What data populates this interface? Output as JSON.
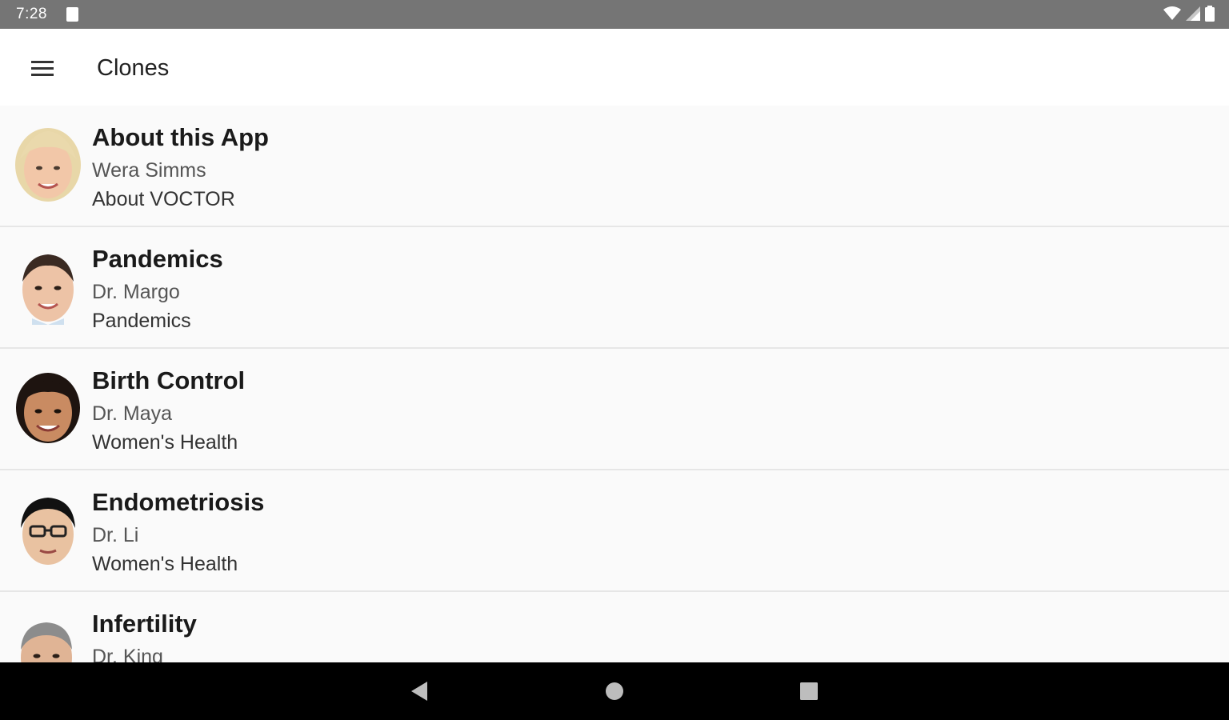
{
  "status_bar": {
    "time": "7:28",
    "icons": [
      "sd-card-icon",
      "wifi-icon",
      "cell-signal-icon",
      "battery-icon"
    ]
  },
  "app_bar": {
    "title": "Clones",
    "menu_icon": "menu-icon"
  },
  "items": [
    {
      "title": "About this App",
      "name": "Wera Simms",
      "category": "About VOCTOR",
      "avatar": "avatar-blonde-woman",
      "skin": "#f2c7a8",
      "hair": "#e8d7a8"
    },
    {
      "title": "Pandemics",
      "name": "Dr. Margo",
      "category": "Pandemics",
      "avatar": "avatar-doctor-woman",
      "skin": "#edc3a6",
      "hair": "#3a2a22"
    },
    {
      "title": "Birth Control",
      "name": "Dr. Maya",
      "category": "Women's Health",
      "avatar": "avatar-doctor-woman-dark-hair",
      "skin": "#c98b62",
      "hair": "#1e1410"
    },
    {
      "title": "Endometriosis",
      "name": "Dr. Li",
      "category": "Women's Health",
      "avatar": "avatar-doctor-man-glasses",
      "skin": "#e9c2a1",
      "hair": "#111111"
    },
    {
      "title": "Infertility",
      "name": "Dr. King",
      "category": "",
      "avatar": "avatar-doctor-man-gray-hair",
      "skin": "#e0b495",
      "hair": "#8c8c8c"
    }
  ],
  "nav_bar": {
    "back": "back-icon",
    "home": "home-icon",
    "recents": "recents-icon"
  },
  "colors": {
    "status_bar": "#757575",
    "app_bar": "#ffffff",
    "list_bg": "#fafafa",
    "divider": "#e6e6e6",
    "nav_bar": "#000000"
  }
}
